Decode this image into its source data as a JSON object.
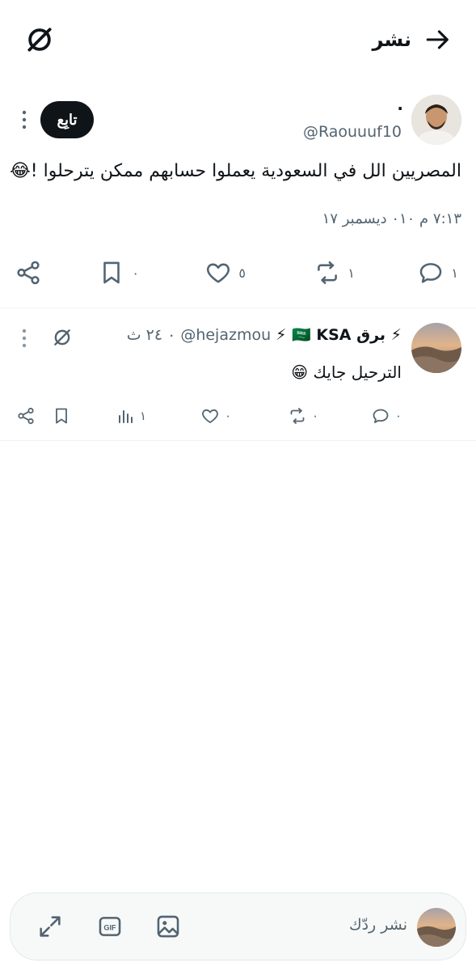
{
  "header": {
    "title": "نشر",
    "back_icon": "arrow-right-icon",
    "grok_icon": "grok-icon"
  },
  "tweet": {
    "display_name": "·",
    "handle": "@Raouuuf10",
    "follow_label": "تابِع",
    "text": "المصريين الل في السعودية يعملوا حسابهم ممكن يترحلوا !😂",
    "timestamp": "٧:١٣ م ٠١٠ ديسمبر ١٧",
    "actions": {
      "replies": "١",
      "reposts": "١",
      "likes": "٥",
      "bookmarks": "٠"
    }
  },
  "reply": {
    "display_name": "⚡ برق 🇸🇦 KSA ⚡",
    "handle": "@hejazmou",
    "time": "٠ ٢٤ ث",
    "text": "الترحيل جايك 😁",
    "actions": {
      "replies": "٠",
      "reposts": "٠",
      "likes": "٠",
      "views": "١"
    }
  },
  "composer": {
    "placeholder": "نشر ردّك",
    "tools": [
      "image-icon",
      "gif-icon",
      "expand-icon"
    ]
  },
  "colors": {
    "text": "#0f1419",
    "muted": "#536471",
    "divider": "#eff3f4",
    "follow_bg": "#0f1419"
  }
}
